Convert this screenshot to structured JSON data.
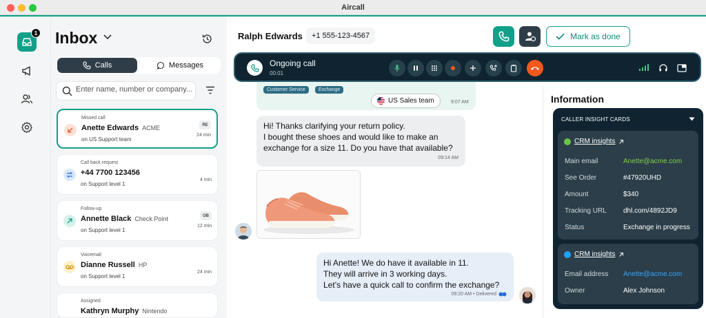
{
  "window": {
    "title": "Aircall"
  },
  "rail": {
    "inbox_badge": "1"
  },
  "inbox": {
    "title": "Inbox",
    "tabs": {
      "calls": "Calls",
      "messages": "Messages"
    },
    "search_placeholder": "Enter name, number or company...",
    "cards": [
      {
        "kind": "Missed call",
        "name": "Anette Edwards",
        "company": "ACME",
        "team": "on  US Support team",
        "duration": "24 min",
        "tag": "RE"
      },
      {
        "kind": "Call back request",
        "name": "+44 7700 123456",
        "company": "",
        "team": "on  Support level 1",
        "duration": "4 min",
        "tag": ""
      },
      {
        "kind": "Follow-up",
        "name": "Annette Black",
        "company": "Check Point",
        "team": "on  Support level 1",
        "duration": "12 min",
        "tag": "OB"
      },
      {
        "kind": "Voicemail",
        "name": "Dianne Russell",
        "company": "HP",
        "team": "on  Support level 1",
        "duration": "24 min",
        "tag": ""
      },
      {
        "kind": "Assigned",
        "name": "Kathryn Murphy",
        "company": "Nintendo",
        "team": "",
        "duration": "",
        "tag": ""
      }
    ]
  },
  "header": {
    "contact_name": "Ralph Edwards",
    "contact_number": "+1 555-123-4567",
    "mark_done": "Mark as done"
  },
  "call": {
    "status": "Ongoing call",
    "timer": "00:01"
  },
  "chat": {
    "chips": [
      "Customer Service",
      "Exchange"
    ],
    "team_pill": "US Sales team",
    "top_time": "9:07 AM",
    "incoming": {
      "lines": [
        "Hi! Thanks clarifying your return policy.",
        "I bought these shoes and would like to make an",
        "exchange for a size 11. Do you have that available?"
      ],
      "time": "09:14 AM"
    },
    "outgoing": {
      "lines": [
        "Hi Anette! We do have it available in 11.",
        "They will arrive in 3 working days.",
        "Let’s have a quick call to confirm the exchange?"
      ],
      "time": "09:20 AM • Delivered"
    }
  },
  "info": {
    "title": "Information",
    "insight_header": "CALLER INSIGHT CARDS",
    "crm1": {
      "title": "CRM insights",
      "rows": [
        {
          "key": "Main email",
          "value": "Anette@acme.com"
        },
        {
          "key": "See Order",
          "value": "#47920UHD"
        },
        {
          "key": "Amount",
          "value": "$340"
        },
        {
          "key": "Tracking URL",
          "value": "dhl.com/4892JD9"
        },
        {
          "key": "Status",
          "value": "Exchange in progress"
        }
      ]
    },
    "crm2": {
      "title": "CRM insights",
      "rows": [
        {
          "key": "Email address",
          "value": "Anette@acme.com"
        },
        {
          "key": "Owner",
          "value": "Alex Johnson"
        }
      ]
    }
  },
  "colors": {
    "brand": "#11a089",
    "dark": "#0f2430",
    "hangup": "#f4581f",
    "crm1_dot": "#6cc24a",
    "crm2_dot": "#1ea4ff"
  }
}
